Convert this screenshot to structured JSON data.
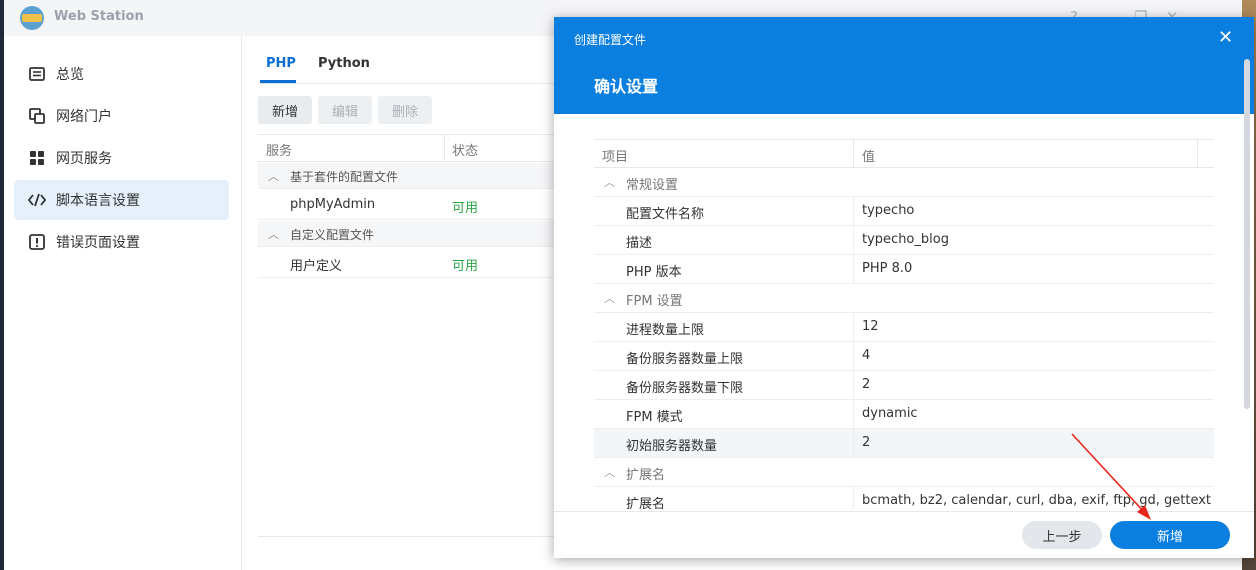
{
  "window": {
    "title": "Web Station",
    "controls": [
      "?",
      "—",
      "❐",
      "✕"
    ]
  },
  "sidebar": {
    "items": [
      {
        "label": "总览",
        "icon": "overview-icon"
      },
      {
        "label": "网络门户",
        "icon": "portal-icon"
      },
      {
        "label": "网页服务",
        "icon": "web-service-icon"
      },
      {
        "label": "脚本语言设置",
        "icon": "code-icon"
      },
      {
        "label": "错误页面设置",
        "icon": "error-page-icon"
      }
    ],
    "active_index": 3
  },
  "main": {
    "tabs": [
      "PHP",
      "Python"
    ],
    "toolbar": {
      "add": "新增",
      "edit": "编辑",
      "delete": "删除"
    },
    "columns": [
      "服务",
      "状态"
    ],
    "groups": [
      {
        "label": "基于套件的配置文件",
        "rows": [
          {
            "name": "phpMyAdmin",
            "status": "可用"
          }
        ]
      },
      {
        "label": "自定义配置文件",
        "rows": [
          {
            "name": "用户定义",
            "status": "可用"
          }
        ]
      }
    ]
  },
  "modal": {
    "subtitle": "创建配置文件",
    "title": "确认设置",
    "columns": [
      "项目",
      "值"
    ],
    "groups": [
      {
        "label": "常规设置",
        "rows": [
          {
            "key": "配置文件名称",
            "value": "typecho"
          },
          {
            "key": "描述",
            "value": "typecho_blog"
          },
          {
            "key": "PHP 版本",
            "value": "PHP 8.0"
          }
        ]
      },
      {
        "label": "FPM 设置",
        "rows": [
          {
            "key": "进程数量上限",
            "value": "12"
          },
          {
            "key": "备份服务器数量上限",
            "value": "4"
          },
          {
            "key": "备份服务器数量下限",
            "value": "2"
          },
          {
            "key": "FPM 模式",
            "value": "dynamic"
          },
          {
            "key": "初始服务器数量",
            "value": "2"
          }
        ]
      },
      {
        "label": "扩展名",
        "rows": [
          {
            "key": "扩展名",
            "value": "bcmath, bz2, calendar, curl, dba, exif, ftp, gd, gettext"
          }
        ]
      }
    ],
    "buttons": {
      "prev": "上一步",
      "add": "新增"
    }
  },
  "colors": {
    "accent": "#0b7fe0",
    "status_ok": "#28a745",
    "active_nav": "#e5f0fb"
  }
}
